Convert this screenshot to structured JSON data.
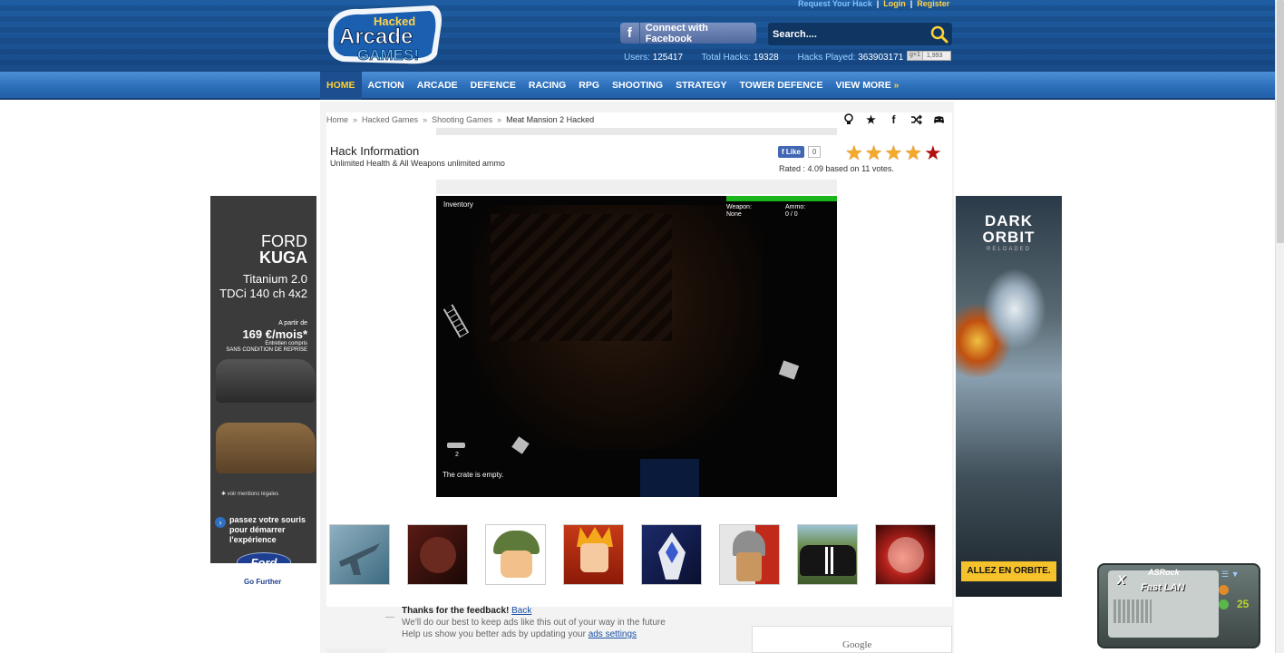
{
  "header": {
    "logo_top": "Hacked",
    "logo_mid": "Arcade",
    "logo_bot": "GAMES!",
    "top_links": [
      "Request Your Hack",
      "Login",
      "Register"
    ],
    "facebook_connect": "Connect with Facebook",
    "search_placeholder": "Search....",
    "stats": [
      {
        "label": "Users:",
        "value": "125417"
      },
      {
        "label": "Total Hacks:",
        "value": "19328"
      },
      {
        "label": "Hacks Played:",
        "value": "363903171"
      }
    ],
    "gplus_label": "g+1",
    "gplus_count": "1,993"
  },
  "nav": {
    "items": [
      "HOME",
      "ACTION",
      "ARCADE",
      "DEFENCE",
      "RACING",
      "RPG",
      "SHOOTING",
      "STRATEGY",
      "TOWER DEFENCE"
    ],
    "more": "VIEW MORE",
    "more_icon": "»",
    "active": "HOME"
  },
  "breadcrumb": {
    "items": [
      "Home",
      "Hacked Games",
      "Shooting Games"
    ],
    "current": "Meat Mansion 2 Hacked",
    "separator": "»"
  },
  "page_icons": [
    "bulb-icon",
    "star-icon",
    "facebook-icon",
    "shuffle-icon",
    "gamepad-icon"
  ],
  "hack": {
    "title": "Hack Information",
    "description": "Unlimited Health & All Weapons unlimited ammo"
  },
  "fb_like": {
    "label": "Like",
    "count": "0"
  },
  "rating": {
    "stars": 5,
    "value": 4.09,
    "text": "Rated : 4.09 based on 11 votes."
  },
  "game": {
    "inventory": "Inventory",
    "weapon_label": "Weapon:",
    "weapon_value": "None",
    "ammo_label": "Ammo:",
    "ammo_value": "0 / 0",
    "count": "2",
    "message": "The crate is empty."
  },
  "thumbnails": [
    "plane",
    "zombie",
    "soldier",
    "ninja",
    "mecha",
    "knight",
    "racing",
    "fire"
  ],
  "feedback": {
    "thanks": "Thanks for the feedback!",
    "back": "Back",
    "line2": "We'll do our best to keep ads like this out of your way in the future",
    "line3_prefix": "Help us show you better ads by updating your",
    "ads_settings": "ads settings",
    "google": "Google"
  },
  "ad_left": {
    "brand": "FORD",
    "model": "KUGA",
    "trim1": "Titanium 2.0",
    "trim2": "TDCi 140 ch 4x2",
    "price_pre": "A partir de",
    "price": "169 €/mois*",
    "price_note1": "Entretien compris",
    "price_note2": "SANS CONDITION DE REPRISE",
    "legal": "voir mentions légales",
    "cta": "passez votre souris pour démarrer l'expérience",
    "logo": "Ford",
    "tagline": "Go Further"
  },
  "ad_right": {
    "title1": "DARK",
    "title2": "ORBIT",
    "subtitle": "RELOADED",
    "cta": "ALLEZ EN ORBITE."
  },
  "widget": {
    "brand": "X",
    "maker": "ASRock",
    "product": "Fast LAN",
    "count": "25"
  }
}
